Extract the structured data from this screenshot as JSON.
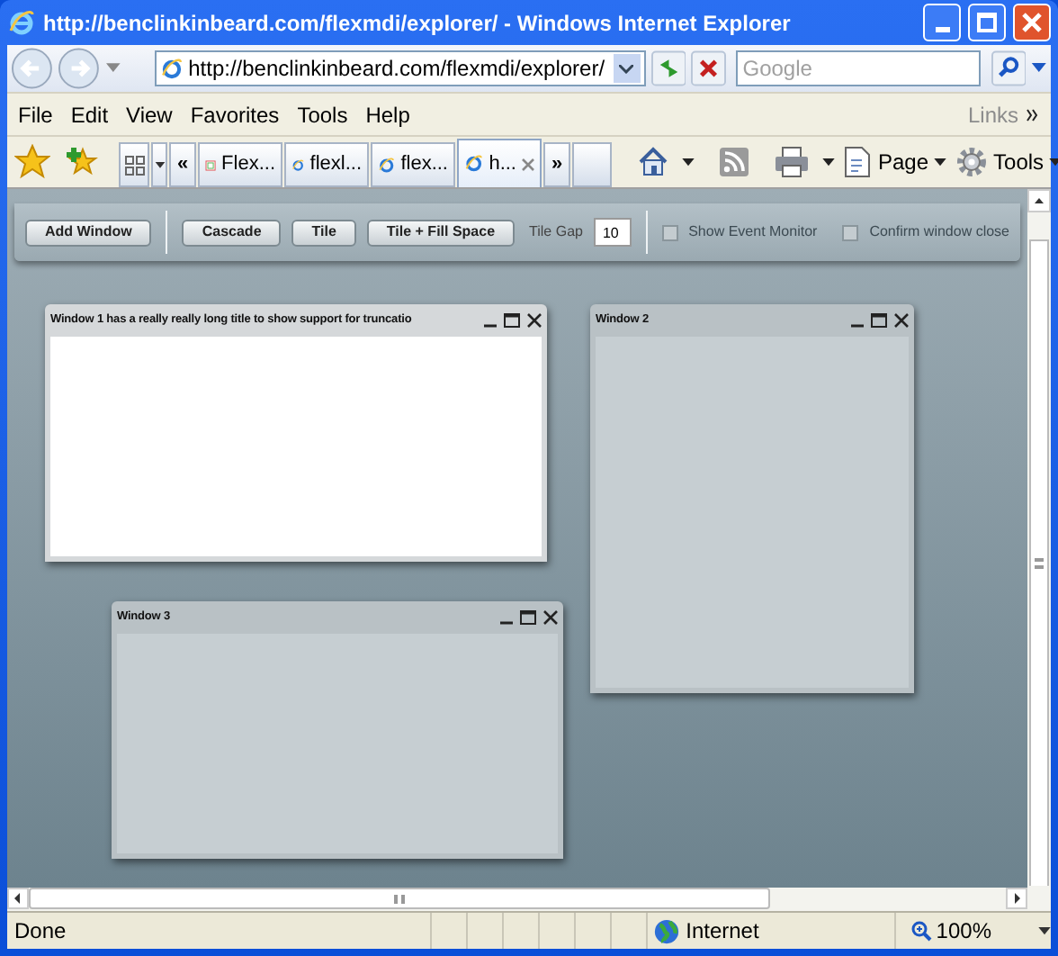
{
  "window": {
    "title": "http://benclinkinbeard.com/flexmdi/explorer/ - Windows Internet Explorer"
  },
  "address_bar": {
    "url": "http://benclinkinbeard.com/flexmdi/explorer/"
  },
  "search": {
    "placeholder": "Google"
  },
  "menu": [
    "File",
    "Edit",
    "View",
    "Favorites",
    "Tools",
    "Help"
  ],
  "links": "Links",
  "tabs": [
    {
      "label": "Flex...",
      "kind": "app",
      "selected": false
    },
    {
      "label": "flexl...",
      "kind": "ie",
      "selected": false
    },
    {
      "label": "flex...",
      "kind": "ie",
      "selected": false
    },
    {
      "label": "h...",
      "kind": "ie",
      "selected": true
    }
  ],
  "tab_overflow": [
    "«",
    "»"
  ],
  "command_bar": [
    {
      "kind": "home"
    },
    {
      "kind": "feeds"
    },
    {
      "kind": "print"
    },
    {
      "kind": "menu",
      "label": "Page"
    },
    {
      "kind": "gear",
      "label": "Tools"
    }
  ],
  "app_toolbar": {
    "buttons": [
      {
        "label": "Add Window"
      },
      {
        "label": "Cascade"
      },
      {
        "label": "Tile"
      },
      {
        "label": "Tile + Fill Space"
      }
    ],
    "tile_gap_label": "Tile Gap",
    "tile_gap": "10",
    "checkboxes": [
      {
        "label": "Show Event Monitor",
        "checked": false
      },
      {
        "label": "Confirm window close",
        "checked": false
      }
    ]
  },
  "mdi_windows": [
    {
      "title": "Window 1 has a really really long title to show support for truncatio",
      "focused": true
    },
    {
      "title": "Window 2",
      "focused": false
    },
    {
      "title": "Window 3",
      "focused": false
    }
  ],
  "status_bar": {
    "status": "Done",
    "zone": "Internet",
    "zoom": "100%"
  }
}
